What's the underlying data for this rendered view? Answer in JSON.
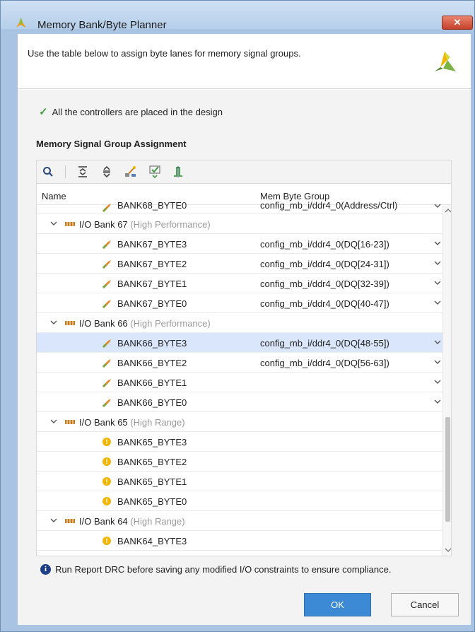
{
  "window": {
    "title": "Memory Bank/Byte Planner",
    "close_label": "✕"
  },
  "header": {
    "description": "Use the table below to assign byte lanes for memory signal groups."
  },
  "status": {
    "message": "All the controllers are placed in the design"
  },
  "section": {
    "title": "Memory Signal Group Assignment"
  },
  "table": {
    "columns": {
      "name": "Name",
      "group": "Mem Byte Group"
    },
    "partial_row": {
      "name": "BANK68_BYTE0",
      "group": "config_mb_i/ddr4_0(Address/Ctrl)"
    },
    "rows": [
      {
        "kind": "bank",
        "name": "I/O Bank 67",
        "sub": "(High Performance)"
      },
      {
        "kind": "byte",
        "name": "BANK67_BYTE3",
        "group": "config_mb_i/ddr4_0(DQ[16-23])",
        "dropdown": true
      },
      {
        "kind": "byte",
        "name": "BANK67_BYTE2",
        "group": "config_mb_i/ddr4_0(DQ[24-31])",
        "dropdown": true
      },
      {
        "kind": "byte",
        "name": "BANK67_BYTE1",
        "group": "config_mb_i/ddr4_0(DQ[32-39])",
        "dropdown": true
      },
      {
        "kind": "byte",
        "name": "BANK67_BYTE0",
        "group": "config_mb_i/ddr4_0(DQ[40-47])",
        "dropdown": true
      },
      {
        "kind": "bank",
        "name": "I/O Bank 66",
        "sub": "(High Performance)"
      },
      {
        "kind": "byte",
        "name": "BANK66_BYTE3",
        "group": "config_mb_i/ddr4_0(DQ[48-55])",
        "dropdown": true,
        "selected": true
      },
      {
        "kind": "byte",
        "name": "BANK66_BYTE2",
        "group": "config_mb_i/ddr4_0(DQ[56-63])",
        "dropdown": true
      },
      {
        "kind": "byte",
        "name": "BANK66_BYTE1",
        "group": "",
        "dropdown": true
      },
      {
        "kind": "byte",
        "name": "BANK66_BYTE0",
        "group": "",
        "dropdown": true
      },
      {
        "kind": "bank",
        "name": "I/O Bank 65",
        "sub": "(High Range)"
      },
      {
        "kind": "hr",
        "name": "BANK65_BYTE3",
        "group": ""
      },
      {
        "kind": "hr",
        "name": "BANK65_BYTE2",
        "group": ""
      },
      {
        "kind": "hr",
        "name": "BANK65_BYTE1",
        "group": ""
      },
      {
        "kind": "hr",
        "name": "BANK65_BYTE0",
        "group": ""
      },
      {
        "kind": "bank",
        "name": "I/O Bank 64",
        "sub": "(High Range)"
      },
      {
        "kind": "hr",
        "name": "BANK64_BYTE3",
        "group": ""
      }
    ]
  },
  "footer": {
    "info": "Run Report DRC before saving any modified I/O constraints to ensure compliance.",
    "ok_label": "OK",
    "cancel_label": "Cancel"
  },
  "colors": {
    "accent": "#3c8ad6",
    "selection": "#d9e6fb",
    "check": "#4aa14a",
    "warn": "#f2b705",
    "title_bar": "#b6cfea"
  }
}
